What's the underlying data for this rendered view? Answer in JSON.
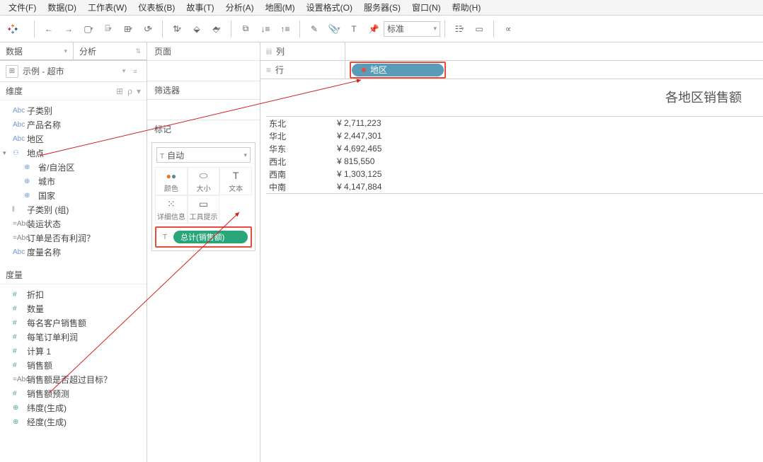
{
  "menu": [
    "文件(F)",
    "数据(D)",
    "工作表(W)",
    "仪表板(B)",
    "故事(T)",
    "分析(A)",
    "地图(M)",
    "设置格式(O)",
    "服务器(S)",
    "窗口(N)",
    "帮助(H)"
  ],
  "toolbar": {
    "std_label": "标准"
  },
  "datapane": {
    "tab_data": "数据",
    "tab_analysis": "分析",
    "ds_name": "示例 - 超市",
    "dim_header": "维度",
    "meas_header": "度量",
    "dims": [
      {
        "icon": "Abc",
        "label": "子类别"
      },
      {
        "icon": "Abc",
        "label": "产品名称"
      },
      {
        "icon": "Abc",
        "label": "地区"
      },
      {
        "icon": "hier",
        "label": "地点",
        "expand": true
      },
      {
        "icon": "geo",
        "label": "省/自治区",
        "indent": true
      },
      {
        "icon": "geo",
        "label": "城市",
        "indent": true
      },
      {
        "icon": "geo",
        "label": "国家",
        "indent": true
      },
      {
        "icon": "grp",
        "label": "子类别 (组)"
      },
      {
        "icon": "calc",
        "label": "装运状态"
      },
      {
        "icon": "calc",
        "label": "订单是否有利润？"
      },
      {
        "icon": "Abc",
        "label": "度量名称"
      }
    ],
    "meas": [
      {
        "icon": "#",
        "label": "折扣"
      },
      {
        "icon": "#",
        "label": "数量"
      },
      {
        "icon": "#",
        "label": "每名客户销售额"
      },
      {
        "icon": "#",
        "label": "每笔订单利润"
      },
      {
        "icon": "#",
        "label": "计算 1"
      },
      {
        "icon": "#",
        "label": "销售额"
      },
      {
        "icon": "calc",
        "label": "销售额是否超过目标？"
      },
      {
        "icon": "#",
        "label": "销售额预测"
      },
      {
        "icon": "geo",
        "label": "纬度(生成)"
      },
      {
        "icon": "geo",
        "label": "经度(生成)"
      }
    ]
  },
  "cards": {
    "pages": "页面",
    "filters": "筛选器",
    "marks": "标记",
    "marks_type": "自动",
    "cells": [
      {
        "lbl": "颜色"
      },
      {
        "lbl": "大小"
      },
      {
        "lbl": "文本"
      },
      {
        "lbl": "详细信息"
      },
      {
        "lbl": "工具提示"
      }
    ],
    "pill_text": "总计(销售额)"
  },
  "shelves": {
    "columns": "列",
    "rows": "行",
    "row_pill": "地区"
  },
  "worksheet": {
    "title": "各地区销售额",
    "rows": [
      {
        "label": "东北",
        "val": "¥ 2,711,223"
      },
      {
        "label": "华北",
        "val": "¥ 2,447,301"
      },
      {
        "label": "华东",
        "val": "¥ 4,692,465"
      },
      {
        "label": "西北",
        "val": "¥ 815,550"
      },
      {
        "label": "西南",
        "val": "¥ 1,303,125"
      },
      {
        "label": "中南",
        "val": "¥ 4,147,884"
      }
    ]
  },
  "chart_data": {
    "type": "table",
    "title": "各地区销售额",
    "categories": [
      "东北",
      "华北",
      "华东",
      "西北",
      "西南",
      "中南"
    ],
    "values": [
      2711223,
      2447301,
      4692465,
      815550,
      1303125,
      4147884
    ],
    "ylabel": "销售额",
    "currency": "¥"
  }
}
